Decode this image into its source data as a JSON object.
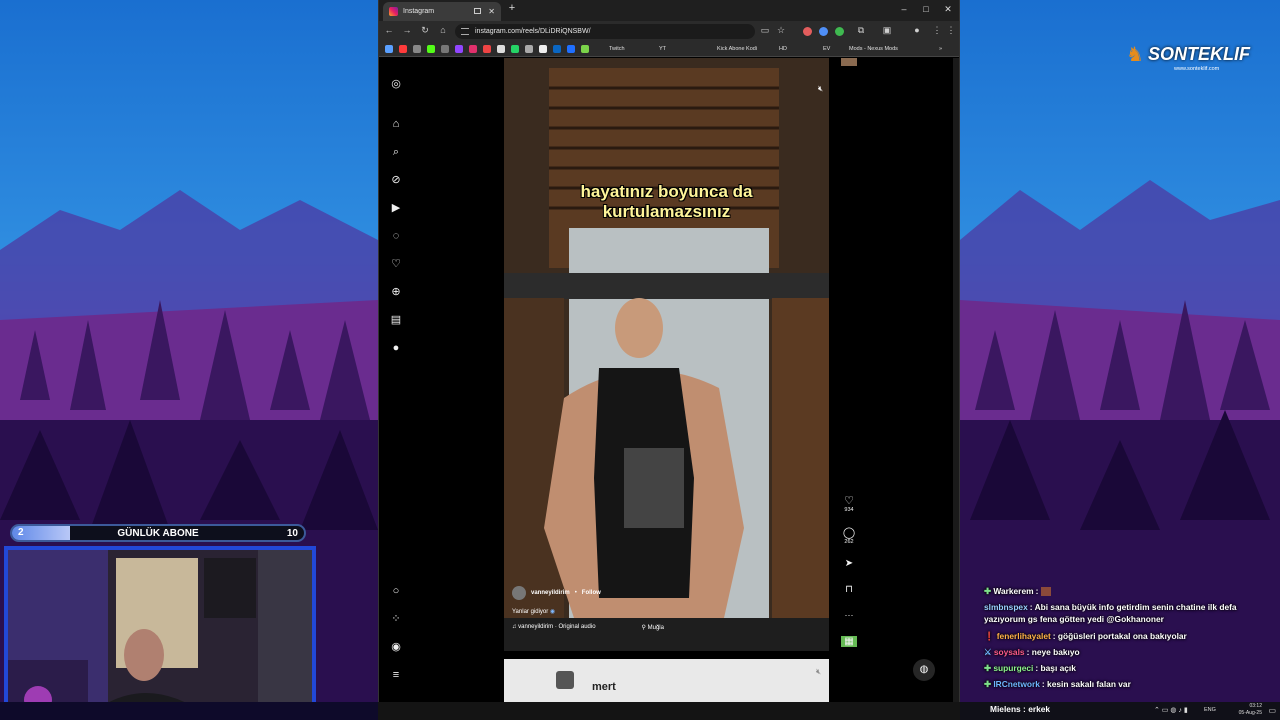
{
  "browser": {
    "tab_title": "Instagram",
    "url": "instagram.com/reels/DLiDRiQNSBW/",
    "bookmarks": [
      "Twitch",
      "YT",
      "Kick Abone Kodi",
      "HD",
      "EV",
      "Mods - Nexus Mods"
    ]
  },
  "reel": {
    "caption_line1": "hayatınız boyunca da",
    "caption_line2": "kurtulamazsınız",
    "username": "vanneyildirim",
    "follow": "Follow",
    "description": "Yanlar gidiyor",
    "audio": "vanneyildirim · Original audio",
    "location": "Muğla",
    "likes": "934",
    "comments": "262",
    "next_user": "mert"
  },
  "goal": {
    "label": "GÜNLÜK ABONE",
    "current": "2",
    "target": "10",
    "progress": 0.2
  },
  "logo": {
    "text": "SONTEKLIF",
    "sub": "www.sonteklif.com"
  },
  "chat": [
    {
      "user": "Warkerem",
      "text": "",
      "color": "#ffffff",
      "badge": "✚"
    },
    {
      "user": "slmbnspex",
      "text": "Abi sana büyük info getirdim senin chatine ilk defa yazıyorum gs fena götten yedi @Gokhanoner",
      "color": "#9ad0ff",
      "badge": ""
    },
    {
      "user": "fenerlihayalet",
      "text": "göğüsleri portakal ona bakıyolar",
      "color": "#ffb347",
      "badge": "!"
    },
    {
      "user": "soysals",
      "text": "neye bakıyo",
      "color": "#ff5c8a",
      "badge": "⚔"
    },
    {
      "user": "supurgeci",
      "text": "başı açık",
      "color": "#8ef58e",
      "badge": "✚"
    },
    {
      "user": "IRCnetwork",
      "text": "kesin sakalı falan var",
      "color": "#6fb6ff",
      "badge": "✚"
    }
  ],
  "taskbar": {
    "chat_user": "Mielens",
    "chat_text": "erkek",
    "lang": "ENG",
    "time": "03:12",
    "date": "05-Aug-25"
  }
}
